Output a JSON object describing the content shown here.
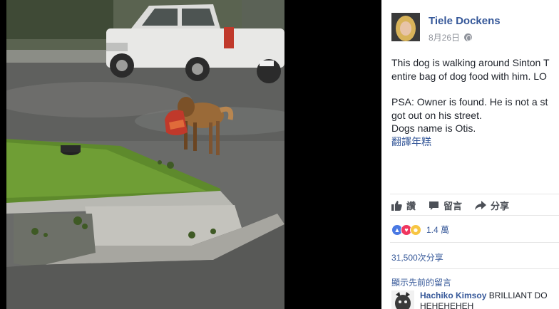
{
  "post": {
    "author": "Tiele Dockens",
    "date": "8月26日",
    "text_lines": [
      "This dog is walking around Sinton T",
      "entire bag of dog food with him. LO"
    ],
    "psa_lines": [
      "PSA: Owner is found. He is not a st",
      "got out on his street.",
      "Dogs name is Otis."
    ],
    "translate_link": "翻譯年糕"
  },
  "actions": {
    "like": "讚",
    "comment": "留言",
    "share": "分享"
  },
  "reactions": {
    "count": "1.4 萬",
    "types": [
      "like",
      "love",
      "haha"
    ]
  },
  "shares": "31,500次分享",
  "previous_comments": "顯示先前的留言",
  "comment": {
    "name": "Hachiko Kimsoy",
    "text": "BRILLIANT DO",
    "line2": "HEHEHEHEH"
  },
  "icons": {
    "visibility": "globe-icon",
    "like": "thumbs-up-icon",
    "comment": "speech-bubble-icon",
    "share": "share-arrow-icon"
  },
  "colors": {
    "link": "#365899",
    "text": "#1d2129",
    "secondary": "#90949c",
    "action": "#4b4f56"
  }
}
